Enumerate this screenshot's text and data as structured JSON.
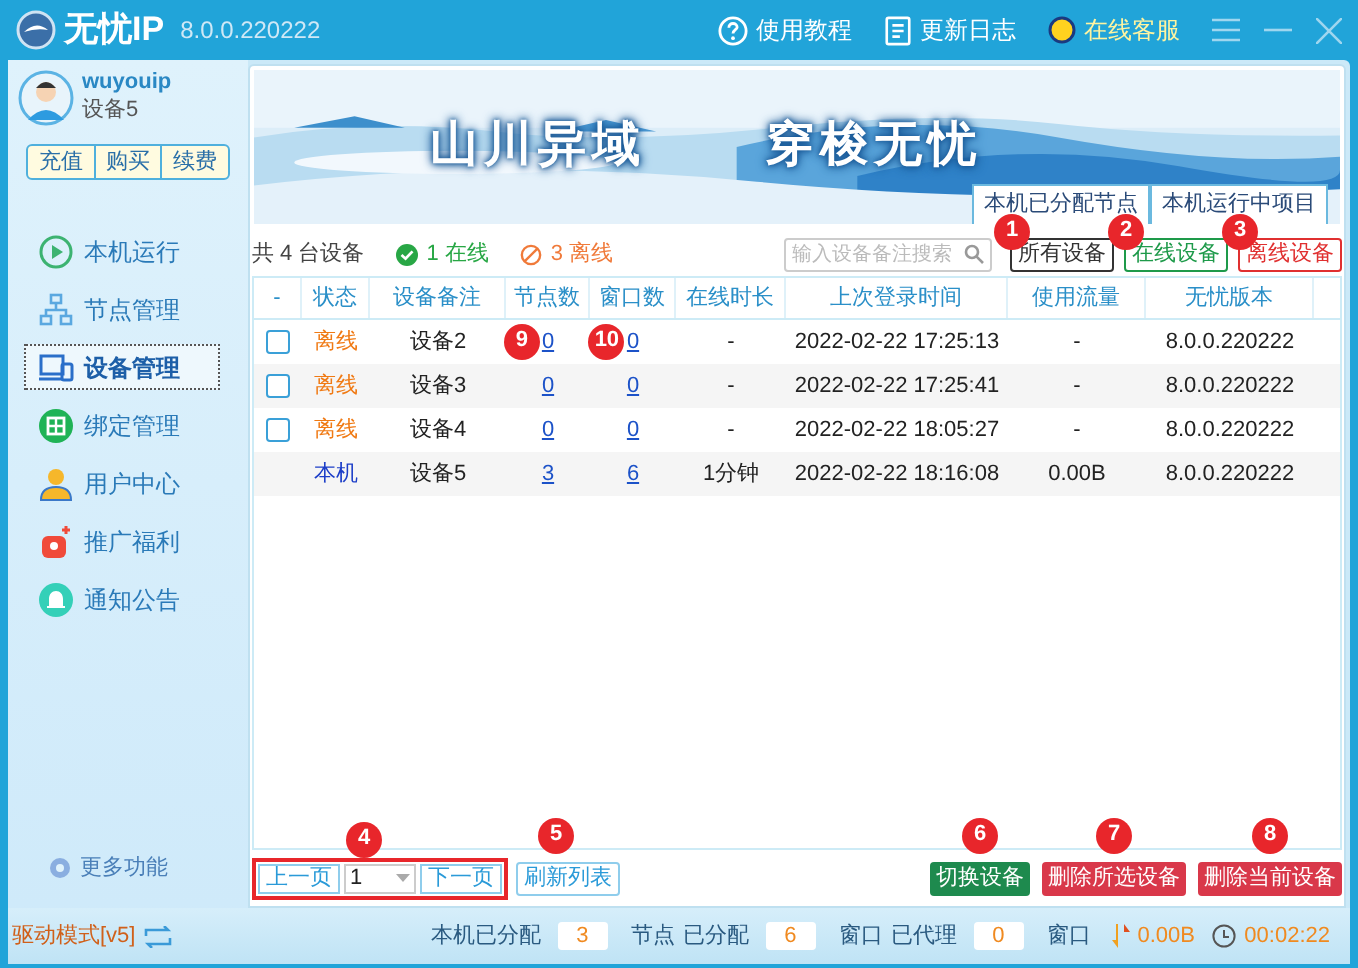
{
  "window": {
    "title": "无忧IP",
    "version": "8.0.0.220222",
    "links": [
      {
        "kind": "help",
        "label": "使用教程"
      },
      {
        "kind": "log",
        "label": "更新日志"
      },
      {
        "kind": "service",
        "label": "在线客服"
      }
    ]
  },
  "user": {
    "name": "wuyouip",
    "device": "设备5",
    "buttons": [
      "充值",
      "购买",
      "续费"
    ]
  },
  "sidebar": {
    "items": [
      {
        "label": "本机运行",
        "selected": false
      },
      {
        "label": "节点管理",
        "selected": false
      },
      {
        "label": "设备管理",
        "selected": true
      },
      {
        "label": "绑定管理",
        "selected": false
      },
      {
        "label": "用户中心",
        "selected": false
      },
      {
        "label": "推广福利",
        "selected": false
      },
      {
        "label": "通知公告",
        "selected": false
      }
    ],
    "more": "更多功能",
    "mode": "驱动模式[v5]"
  },
  "banner": {
    "slogans": [
      "山川异域",
      "穿梭无忧"
    ],
    "tabs": [
      {
        "label": "本机已分配节点",
        "selected": false
      },
      {
        "label": "本机运行中项目",
        "selected": false
      }
    ]
  },
  "summary": {
    "total": "共 4 台设备",
    "online": "1 在线",
    "offline": "3 离线"
  },
  "search": {
    "placeholder": "输入设备备注搜索"
  },
  "filters": [
    {
      "label": "所有设备",
      "color": "#333333",
      "callout": "1"
    },
    {
      "label": "在线设备",
      "color": "#1e9a4a",
      "callout": "2"
    },
    {
      "label": "离线设备",
      "color": "#e03030",
      "callout": "3"
    }
  ],
  "table": {
    "columns": [
      "-",
      "状态",
      "设备备注",
      "节点数",
      "窗口数",
      "在线时长",
      "上次登录时间",
      "使用流量",
      "无忧版本"
    ],
    "rows": [
      {
        "checked": false,
        "status": "离线",
        "kind": "offline",
        "name": "设备2",
        "nodes": "0",
        "windows": "0",
        "duration": "-",
        "last_login": "2022-02-22 17:25:13",
        "traffic": "-",
        "version": "8.0.0.220222",
        "nodes_callout": "9",
        "windows_callout": "10"
      },
      {
        "checked": false,
        "status": "离线",
        "kind": "offline",
        "name": "设备3",
        "nodes": "0",
        "windows": "0",
        "duration": "-",
        "last_login": "2022-02-22 17:25:41",
        "traffic": "-",
        "version": "8.0.0.220222"
      },
      {
        "checked": false,
        "status": "离线",
        "kind": "offline",
        "name": "设备4",
        "nodes": "0",
        "windows": "0",
        "duration": "-",
        "last_login": "2022-02-22 18:05:27",
        "traffic": "-",
        "version": "8.0.0.220222"
      },
      {
        "status": "本机",
        "kind": "local",
        "name": "设备5",
        "nodes": "3",
        "windows": "6",
        "duration": "1分钟",
        "last_login": "2022-02-22 18:16:08",
        "traffic": "0.00B",
        "version": "8.0.0.220222"
      }
    ]
  },
  "pager": {
    "prev": "上一页",
    "page": "1",
    "next": "下一页",
    "callout": "4"
  },
  "refresh": {
    "label": "刷新列表",
    "callout": "5"
  },
  "actions": [
    {
      "label": "切换设备",
      "kind": "switch",
      "callout": "6"
    },
    {
      "label": "删除所选设备",
      "kind": "delete",
      "callout": "7"
    },
    {
      "label": "删除当前设备",
      "kind": "delete",
      "callout": "8"
    }
  ],
  "status_bar": {
    "items": [
      {
        "kind": "label",
        "text": "本机已分配"
      },
      {
        "kind": "value",
        "text": "3"
      },
      {
        "kind": "label",
        "text": "节点"
      },
      {
        "kind": "label",
        "text": "已分配"
      },
      {
        "kind": "value",
        "text": "6"
      },
      {
        "kind": "label",
        "text": "窗口"
      },
      {
        "kind": "label",
        "text": "已代理"
      },
      {
        "kind": "value",
        "text": "0"
      },
      {
        "kind": "label",
        "text": "窗口"
      }
    ],
    "traffic": "0.00B",
    "time": "00:02:22"
  }
}
